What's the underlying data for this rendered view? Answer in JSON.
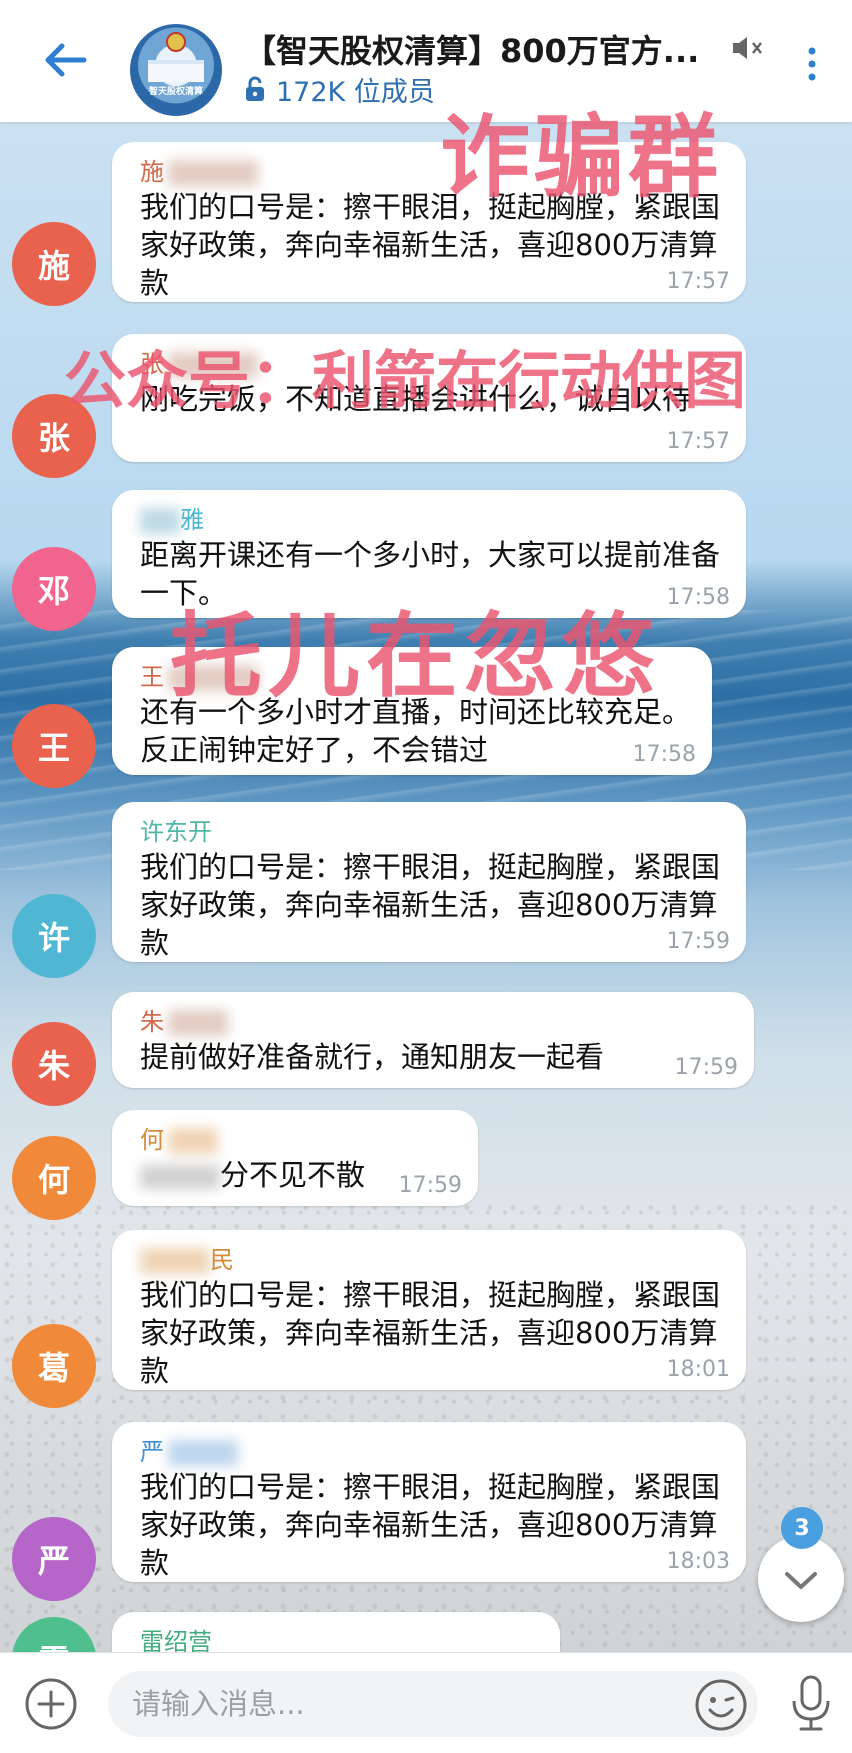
{
  "header": {
    "title": "【智天股权清算】800万官方...",
    "members": "172K 位成员",
    "avatar_text": "智天股权清算"
  },
  "messages": [
    {
      "avatar": "施",
      "color": "#e8624e",
      "name": "施",
      "text": "我们的口号是：擦干眼泪，挺起胸膛，紧跟国家好政策，奔向幸福新生活，喜迎800万清算款",
      "time": "17:57"
    },
    {
      "avatar": "张",
      "color": "#e8624e",
      "name": "张",
      "text": "刚吃完饭，不知道直播会讲什么，诚自以待",
      "time": "17:57"
    },
    {
      "avatar": "邓",
      "color": "#f0648e",
      "name": "雅",
      "text": "距离开课还有一个多小时，大家可以提前准备一下。",
      "time": "17:58"
    },
    {
      "avatar": "王",
      "color": "#e8624e",
      "name": "王",
      "text": "还有一个多小时才直播，时间还比较充足。反正闹钟定好了，不会错过",
      "time": "17:58"
    },
    {
      "avatar": "许",
      "color": "#4fb7d3",
      "name": "许东开",
      "text": "我们的口号是：擦干眼泪，挺起胸膛，紧跟国家好政策，奔向幸福新生活，喜迎800万清算款",
      "time": "17:59"
    },
    {
      "avatar": "朱",
      "color": "#e8624e",
      "name": "朱",
      "text": "提前做好准备就行，通知朋友一起看",
      "time": "17:59"
    },
    {
      "avatar": "何",
      "color": "#f08a3a",
      "name": "何",
      "text": "分不见不散",
      "time": "17:59"
    },
    {
      "avatar": "葛",
      "color": "#f08a3a",
      "name": "民",
      "text": "我们的口号是：擦干眼泪，挺起胸膛，紧跟国家好政策，奔向幸福新生活，喜迎800万清算款",
      "time": "18:01"
    },
    {
      "avatar": "严",
      "color": "#b665c8",
      "name": "严",
      "text": "我们的口号是：擦干眼泪，挺起胸膛，紧跟国家好政策，奔向幸福新生活，喜迎800万清算款",
      "time": "18:03"
    },
    {
      "avatar": "雷",
      "color": "#4fc08d",
      "name": "雷绍营",
      "text": "",
      "time": ""
    }
  ],
  "watermarks": {
    "scam_group": "诈骗群",
    "source": "公众号：利箭在行动供图",
    "shill": "托儿在忽悠"
  },
  "scroll": {
    "unread_count": "3"
  },
  "input": {
    "placeholder": "请输入消息..."
  }
}
